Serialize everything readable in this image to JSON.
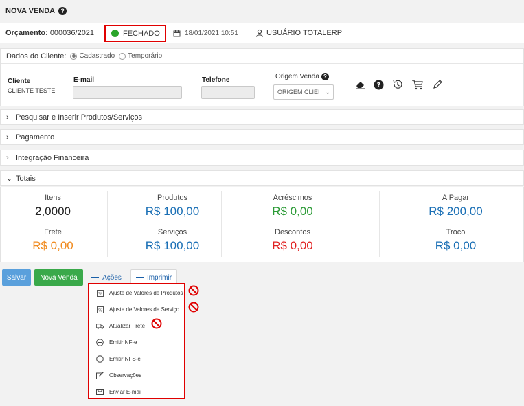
{
  "header": {
    "title": "NOVA VENDA"
  },
  "orcamento": {
    "label": "Orçamento:",
    "number": "000036/2021",
    "status": "FECHADO",
    "date": "18/01/2021 10:51",
    "user": "USUÁRIO TOTALERP"
  },
  "cliente": {
    "section_label": "Dados do Cliente:",
    "radio_cadastrado": "Cadastrado",
    "radio_temporario": "Temporário",
    "cliente_label": "Cliente",
    "cliente_value": "CLIENTE TESTE",
    "email_label": "E-mail",
    "telefone_label": "Telefone",
    "origem_label": "Origem Venda",
    "origem_value": "ORIGEM CLIEI"
  },
  "sections": [
    {
      "label": "Pesquisar e Inserir Produtos/Serviços"
    },
    {
      "label": "Pagamento"
    },
    {
      "label": "Integração Financeira"
    },
    {
      "label": "Totais"
    }
  ],
  "totals": {
    "itens_label": "Itens",
    "itens_value": "2,0000",
    "produtos_label": "Produtos",
    "produtos_value": "R$ 100,00",
    "acrescimos_label": "Acréscimos",
    "acrescimos_value": "R$ 0,00",
    "apagar_label": "A Pagar",
    "apagar_value": "R$ 200,00",
    "frete_label": "Frete",
    "frete_value": "R$ 0,00",
    "servicos_label": "Serviços",
    "servicos_value": "R$ 100,00",
    "descontos_label": "Descontos",
    "descontos_value": "R$ 0,00",
    "troco_label": "Troco",
    "troco_value": "R$ 0,00"
  },
  "buttons": {
    "salvar": "Salvar",
    "nova_venda": "Nova Venda",
    "acoes": "Ações",
    "imprimir": "Imprimir"
  },
  "menu": {
    "items": [
      "Ajuste de Valores de Produtos",
      "Ajuste de Valores de Serviço",
      "Atualizar Frete",
      "Emitir NF-e",
      "Emitir NFS-e",
      "Observações",
      "Enviar E-mail"
    ]
  },
  "colors": {
    "status_dot": "#2aa52a",
    "highlight": "#e00000",
    "blue_value": "#1a6fb5",
    "green_value": "#2a9a35",
    "orange_value": "#f08a1e",
    "red_value": "#e02020"
  }
}
